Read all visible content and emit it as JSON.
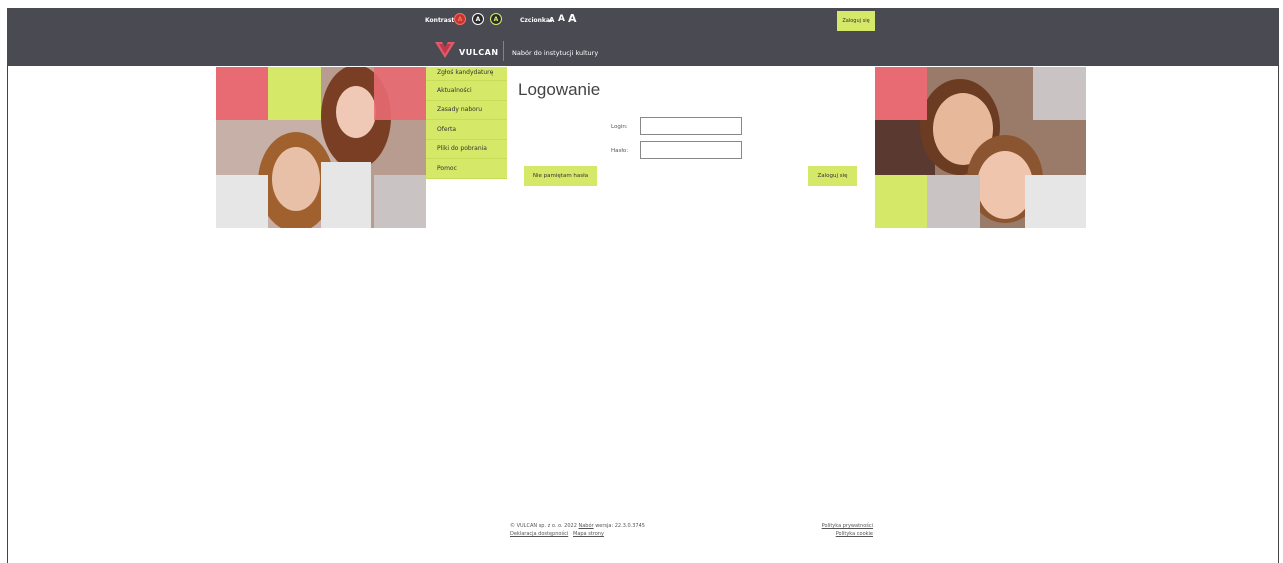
{
  "header": {
    "contrast_label": "Kontrast:",
    "contrast_buttons": [
      "A",
      "A",
      "A"
    ],
    "font_label": "Czcionka:",
    "font_sizes": [
      "A",
      "A",
      "A"
    ],
    "top_login_label": "Zaloguj się",
    "logo_text": "VULCAN",
    "app_title": "Nabór do instytucji kultury"
  },
  "menu": {
    "items": [
      {
        "label": "Zgłoś kandydaturę"
      },
      {
        "label": "Aktualności"
      },
      {
        "label": "Zasady naboru"
      },
      {
        "label": "Oferta"
      },
      {
        "label": "Pliki do pobrania"
      },
      {
        "label": "Pomoc"
      }
    ]
  },
  "login": {
    "title": "Logowanie",
    "login_label": "Login:",
    "login_value": "",
    "password_label": "Hasło:",
    "password_value": "",
    "forgot_label": "Nie pamiętam hasła",
    "submit_label": "Zaloguj się"
  },
  "footer": {
    "copyright": "© VULCAN sp. z o. o. 2022",
    "product_link": "Nabór",
    "version": "wersja: 22.3.0.3745",
    "accessibility_link": "Deklaracja dostępności",
    "sitemap_link": "Mapa strony",
    "privacy_link": "Polityka prywatności",
    "cookie_link": "Polityka cookie"
  },
  "colors": {
    "header_bg": "#4a4a52",
    "accent_lime": "#d6e868",
    "accent_pink": "#e86a72",
    "tile_grey": "#e5e5e5"
  }
}
